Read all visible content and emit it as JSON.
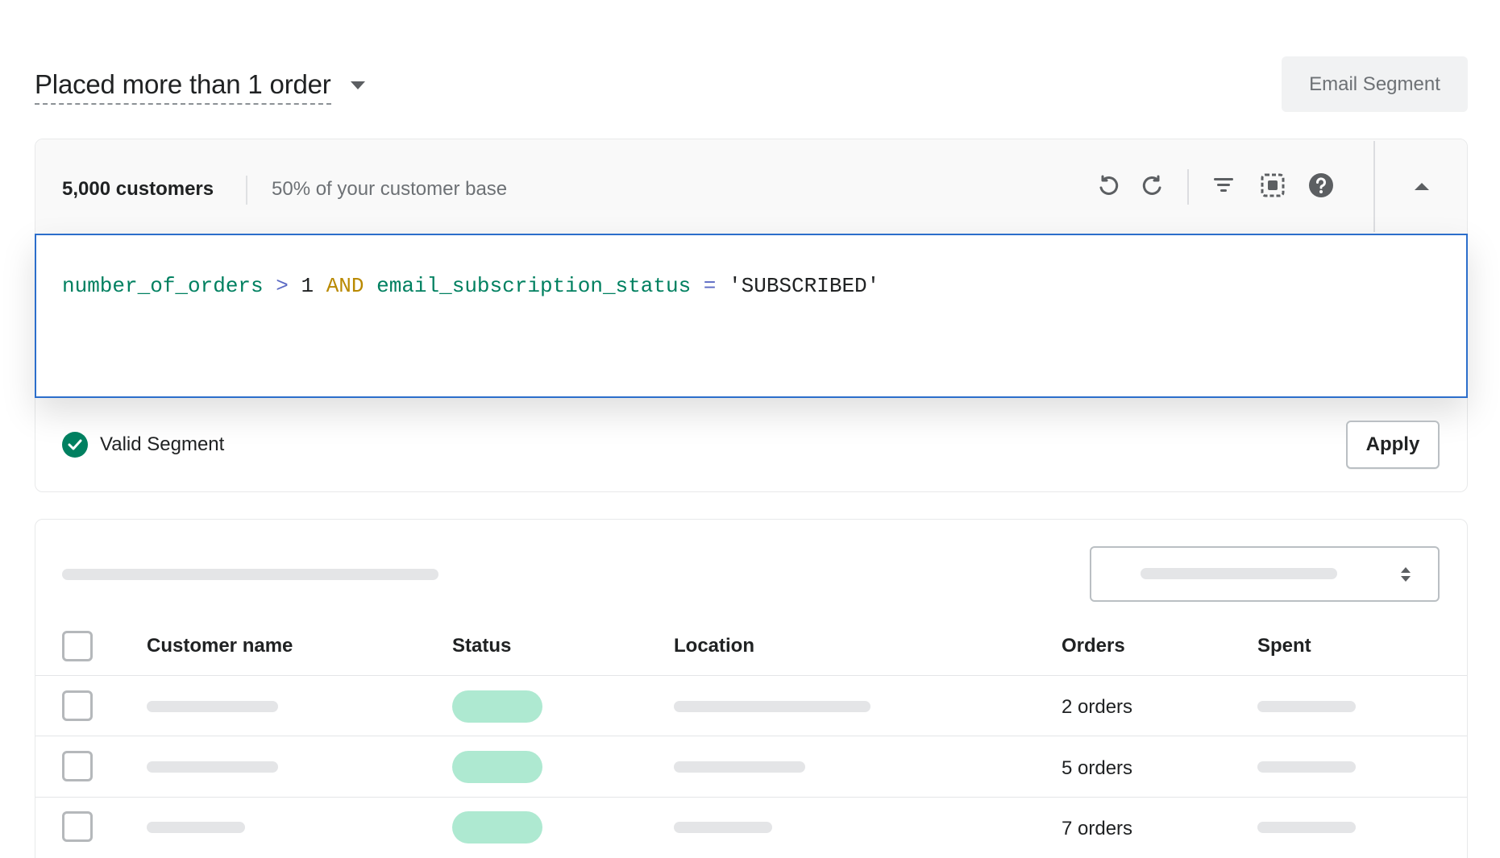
{
  "header": {
    "segment_title": "Placed more than 1 order",
    "email_segment_button": "Email Segment"
  },
  "editor": {
    "customer_count": "5,000 customers",
    "customer_share": "50% of your customer base",
    "toolbar_icons": [
      "undo-icon",
      "redo-icon",
      "filter-icon",
      "select-all-icon",
      "help-icon",
      "collapse-icon"
    ],
    "query_tokens": {
      "field1": "number_of_orders",
      "op1": ">",
      "value1": "1",
      "keyword": "AND",
      "field2": "email_subscription_status",
      "op2": "=",
      "value2": "'SUBSCRIBED'"
    },
    "validation_text": "Valid Segment",
    "apply_button": "Apply"
  },
  "table": {
    "columns": {
      "name": "Customer name",
      "status": "Status",
      "location": "Location",
      "orders": "Orders",
      "spent": "Spent"
    },
    "rows": [
      {
        "orders": "2 orders"
      },
      {
        "orders": "5 orders"
      },
      {
        "orders": "7 orders"
      }
    ]
  },
  "colors": {
    "accent_green": "#008060",
    "focus_blue": "#2c6ecb",
    "status_pill": "#aee9d1",
    "keyword": "#b98900",
    "operator": "#5c6ac4"
  }
}
